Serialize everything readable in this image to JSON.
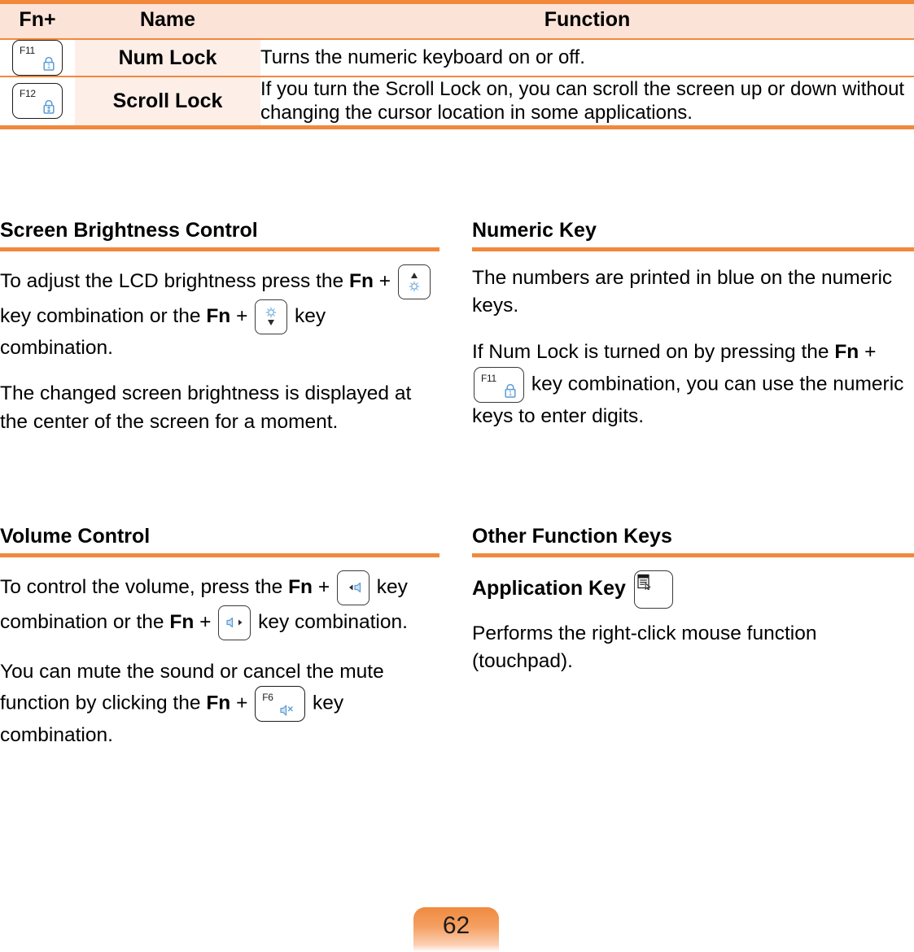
{
  "theme": {
    "accent_orange": "#f2883c",
    "header_bg": "#fbe3d7",
    "name_cell_bg": "#fdeee8",
    "key_glyph_blue": "#5b9bd5",
    "text_black": "#000000"
  },
  "table": {
    "headers": {
      "fn": "Fn+",
      "name": "Name",
      "function": "Function"
    },
    "rows": [
      {
        "key_label": "F11",
        "key_icon": "lock-numlock-icon",
        "name": "Num Lock",
        "function": "Turns the numeric keyboard on or off."
      },
      {
        "key_label": "F12",
        "key_icon": "lock-scrolllock-icon",
        "name": "Scroll Lock",
        "function": "If you turn the Scroll Lock on, you can scroll the screen up or down without changing the cursor location in some applications."
      }
    ]
  },
  "sections": {
    "brightness": {
      "title": "Screen Brightness Control",
      "p1_a": "To adjust the LCD brightness press the",
      "p1_fn1": "Fn",
      "p1_plus1": "+",
      "key1_icon": "brightness-up-icon",
      "p1_b": "key combination or the",
      "p1_fn2": "Fn",
      "p1_plus2": "+",
      "key2_icon": "brightness-down-icon",
      "p1_c": "key combination.",
      "p2": "The changed screen brightness is displayed at the center of the screen for a moment."
    },
    "numeric": {
      "title": "Numeric Key",
      "p1": "The numbers are printed in blue on the numeric keys.",
      "p2_a": "If Num Lock is turned on by pressing the",
      "p2_fn": "Fn",
      "p2_plus": "+",
      "key_label": "F11",
      "key_icon": "lock-numlock-icon",
      "p2_b": "key combination, you can use the numeric keys to enter digits."
    },
    "volume": {
      "title": "Volume Control",
      "p1_a": "To control the volume, press the",
      "p1_fn1": "Fn",
      "p1_plus1": "+",
      "key1_icon": "volume-down-icon",
      "p1_b": "key combination or the",
      "p1_fn2": "Fn",
      "p1_plus2": "+",
      "key2_icon": "volume-up-icon",
      "p1_c": "key combination.",
      "p2_a": "You can mute the sound or cancel the mute function by clicking the",
      "p2_fn": "Fn",
      "p2_plus": "+",
      "key_label": "F6",
      "key_icon": "volume-mute-icon",
      "p2_b": "key combination."
    },
    "other": {
      "title": "Other Function Keys",
      "sub_title": "Application Key",
      "key_icon": "application-menu-icon",
      "p1": "Performs the right-click mouse function (touchpad)."
    }
  },
  "footer": {
    "page_number": "62"
  }
}
